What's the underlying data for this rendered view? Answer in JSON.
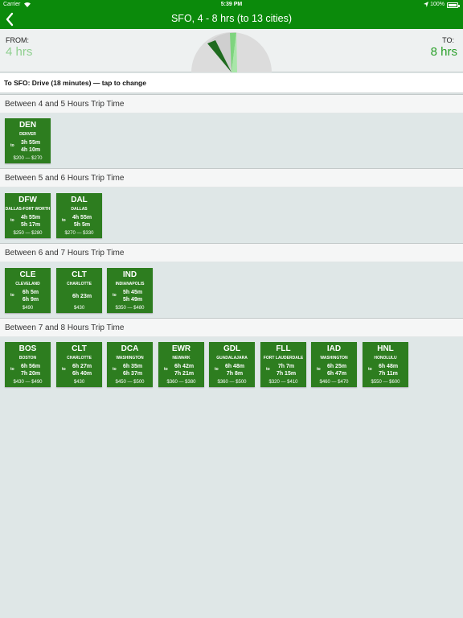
{
  "status": {
    "carrier": "Carrier",
    "time": "5:39 PM",
    "battery": "100%"
  },
  "nav": {
    "title": "SFO, 4 - 8 hrs (to 13 cities)"
  },
  "range": {
    "from_label": "FROM:",
    "from_value": "4 hrs",
    "to_label": "TO:",
    "to_value": "8 hrs"
  },
  "drive": {
    "text": "To SFO: Drive (18 minutes) — tap to change"
  },
  "colors": {
    "brand": "#0b8a0b",
    "tile": "#2d7d1f",
    "from": "#8fcf8f",
    "to": "#2aa02a"
  },
  "sections": [
    {
      "title": "Between 4 and 5 Hours Trip Time",
      "tiles": [
        {
          "code": "DEN",
          "city": "DENVER",
          "to": "to",
          "times": [
            "3h 55m",
            "4h 10m"
          ],
          "price": "$200 — $270"
        }
      ]
    },
    {
      "title": "Between 5 and 6 Hours Trip Time",
      "tiles": [
        {
          "code": "DFW",
          "city": "DALLAS-FORT WORTH",
          "to": "to",
          "times": [
            "4h 55m",
            "5h 17m"
          ],
          "price": "$250 — $280"
        },
        {
          "code": "DAL",
          "city": "DALLAS",
          "to": "to",
          "times": [
            "4h 55m",
            "5h 5m"
          ],
          "price": "$270 — $330"
        }
      ]
    },
    {
      "title": "Between 6 and 7 Hours Trip Time",
      "tiles": [
        {
          "code": "CLE",
          "city": "CLEVELAND",
          "to": "to",
          "times": [
            "6h 5m",
            "6h 9m"
          ],
          "price": "$490"
        },
        {
          "code": "CLT",
          "city": "CHARLOTTE",
          "to": "",
          "times": [
            "6h 23m"
          ],
          "price": "$430"
        },
        {
          "code": "IND",
          "city": "INDIANAPOLIS",
          "to": "to",
          "times": [
            "5h 45m",
            "5h 49m"
          ],
          "price": "$350 — $480"
        }
      ]
    },
    {
      "title": "Between 7 and 8 Hours Trip Time",
      "tiles": [
        {
          "code": "BOS",
          "city": "BOSTON",
          "to": "to",
          "times": [
            "6h 56m",
            "7h 20m"
          ],
          "price": "$430 — $490"
        },
        {
          "code": "CLT",
          "city": "CHARLOTTE",
          "to": "to",
          "times": [
            "6h 27m",
            "6h 40m"
          ],
          "price": "$430"
        },
        {
          "code": "DCA",
          "city": "WASHINGTON",
          "to": "to",
          "times": [
            "6h 35m",
            "6h 37m"
          ],
          "price": "$450 — $500"
        },
        {
          "code": "EWR",
          "city": "NEWARK",
          "to": "to",
          "times": [
            "6h 42m",
            "7h 21m"
          ],
          "price": "$360 — $380"
        },
        {
          "code": "GDL",
          "city": "GUADALAJARA",
          "to": "to",
          "times": [
            "6h 48m",
            "7h 8m"
          ],
          "price": "$360 — $500"
        },
        {
          "code": "FLL",
          "city": "FORT LAUDERDALE",
          "to": "to",
          "times": [
            "7h 7m",
            "7h 15m"
          ],
          "price": "$320 — $410"
        },
        {
          "code": "IAD",
          "city": "WASHINGTON",
          "to": "to",
          "times": [
            "6h 25m",
            "6h 47m"
          ],
          "price": "$460 — $470"
        },
        {
          "code": "HNL",
          "city": "HONOLULU",
          "to": "to",
          "times": [
            "6h 48m",
            "7h 11m"
          ],
          "price": "$550 — $600"
        }
      ]
    }
  ]
}
